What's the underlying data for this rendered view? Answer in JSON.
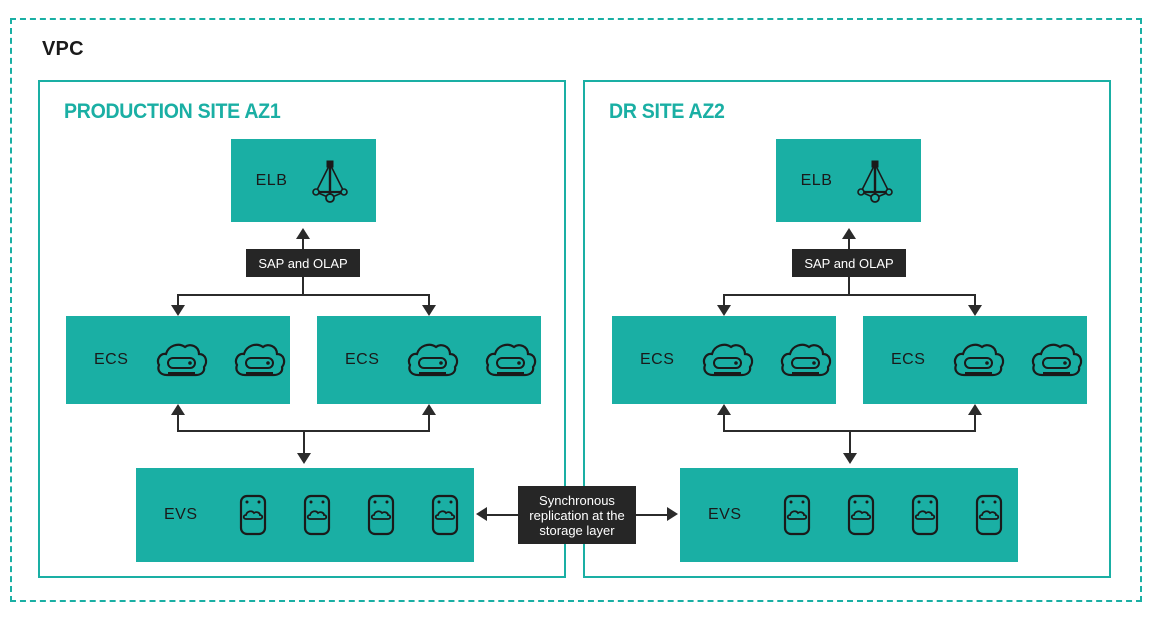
{
  "diagram": {
    "vpc": {
      "label": "VPC"
    },
    "sites": [
      {
        "id": "production",
        "title": "PRODUCTION SITE AZ1",
        "elb": {
          "label": "ELB",
          "icon": "elb-pyramid-icon"
        },
        "flow_label": "SAP and OLAP",
        "ecs_nodes": [
          {
            "label": "ECS",
            "icon_count": 2,
            "icon": "ecs-cloud-server-icon"
          },
          {
            "label": "ECS",
            "icon_count": 2,
            "icon": "ecs-cloud-server-icon"
          }
        ],
        "evs": {
          "label": "EVS",
          "icon_count": 4,
          "icon": "evs-disk-cloud-icon"
        }
      },
      {
        "id": "dr",
        "title": "DR SITE AZ2",
        "elb": {
          "label": "ELB",
          "icon": "elb-pyramid-icon"
        },
        "flow_label": "SAP and OLAP",
        "ecs_nodes": [
          {
            "label": "ECS",
            "icon_count": 2,
            "icon": "ecs-cloud-server-icon"
          },
          {
            "label": "ECS",
            "icon_count": 2,
            "icon": "ecs-cloud-server-icon"
          }
        ],
        "evs": {
          "label": "EVS",
          "icon_count": 4,
          "icon": "evs-disk-cloud-icon"
        }
      }
    ],
    "replication": {
      "label_line1": "Synchronous",
      "label_line2": "replication at the",
      "label_line3": "storage layer",
      "direction": "bidirectional"
    }
  },
  "colors": {
    "teal": "#1AAFA4",
    "black_label": "#262626",
    "connector": "#2b2b2b",
    "text_dark": "#1a1a1a",
    "white": "#ffffff"
  }
}
